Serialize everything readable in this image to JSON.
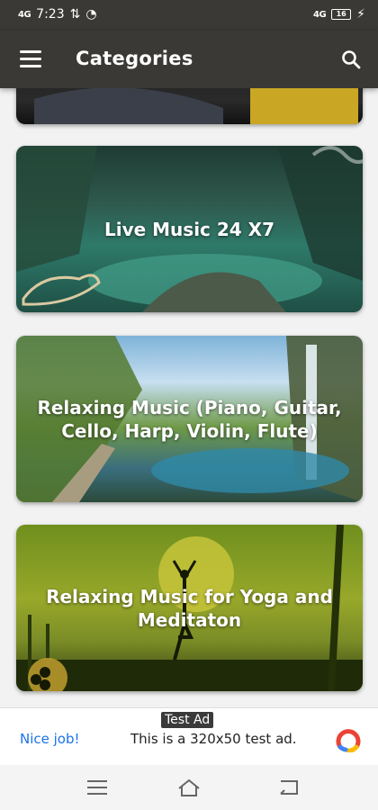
{
  "status": {
    "time": "7:23",
    "signal_left": "4G",
    "signal_right": "4G",
    "battery": "16"
  },
  "appbar": {
    "title": "Categories"
  },
  "categories": [
    {
      "label": ""
    },
    {
      "label": "Live Music 24 X7"
    },
    {
      "label": "Relaxing Music (Piano, Guitar, Cello, Harp, Violin, Flute)"
    },
    {
      "label": "Relaxing Music for Yoga and Meditaton"
    }
  ],
  "ad": {
    "badge": "Test Ad",
    "cta": "Nice job!",
    "text": "This is a 320x50 test ad."
  },
  "colors": {
    "appbar": "#3a3935",
    "ad_cta": "#1a73e8"
  },
  "icons": [
    "menu-icon",
    "search-icon",
    "wifi-icon",
    "alarm-icon",
    "back-icon",
    "home-icon",
    "recents-icon",
    "ad-logo-icon"
  ]
}
